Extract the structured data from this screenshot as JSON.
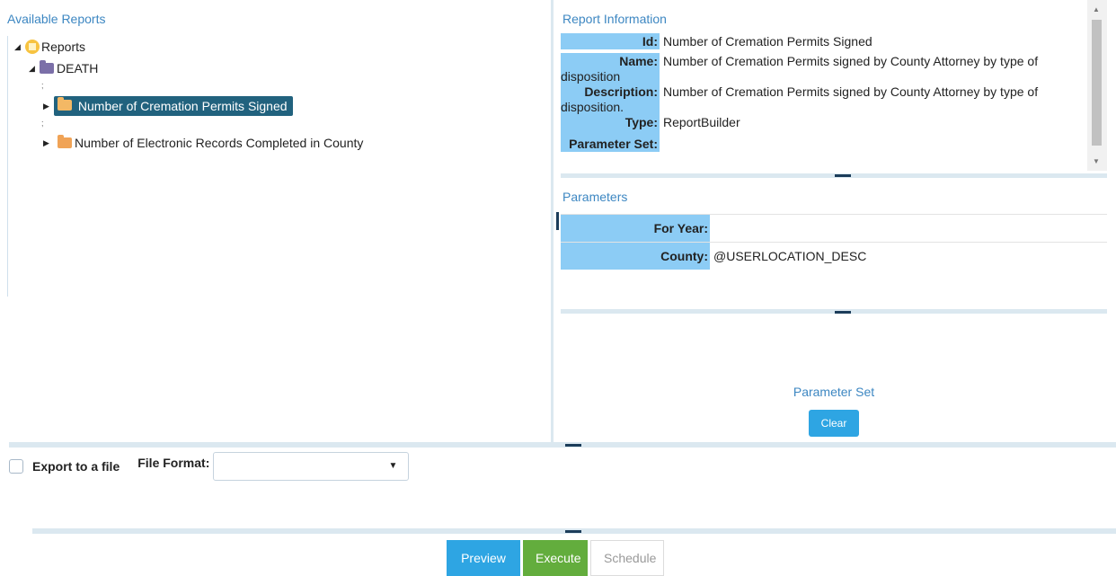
{
  "tree": {
    "title": "Available Reports",
    "root_label": "Reports",
    "category_label": "DEATH",
    "items": [
      {
        "label": "Number of Cremation Permits Signed",
        "selected": true
      },
      {
        "label": "Number of Electronic Records Completed in County",
        "selected": false
      }
    ],
    "separator": ";"
  },
  "report_info": {
    "title": "Report Information",
    "id_key": "Id:",
    "id_val": "Number of Cremation Permits Signed",
    "name_key": "Name:",
    "name_val": "Number of Cremation Permits signed by County Attorney by type of",
    "name_wrap": "disposition",
    "desc_key": "Description:",
    "desc_val": "Number of Cremation Permits signed by County Attorney by type of",
    "desc_wrap": "disposition.",
    "type_key": "Type:",
    "type_val": "ReportBuilder",
    "paramset_key": "Parameter Set:"
  },
  "parameters": {
    "title": "Parameters",
    "year_key": "For Year:",
    "year_val": "",
    "county_key": "County:",
    "county_val": "@USERLOCATION_DESC"
  },
  "parameter_set": {
    "label": "Parameter Set",
    "clear_label": "Clear"
  },
  "export": {
    "checkbox_label": "Export to a file",
    "format_label": "File Format:",
    "format_value": ""
  },
  "actions": {
    "preview": "Preview",
    "execute": "Execute",
    "schedule": "Schedule"
  },
  "colors": {
    "accent": "#3d87c2",
    "key_bg": "#8cccf5",
    "selected_bg": "#21627e",
    "preview": "#2ea5e3",
    "execute": "#63ad3d"
  }
}
